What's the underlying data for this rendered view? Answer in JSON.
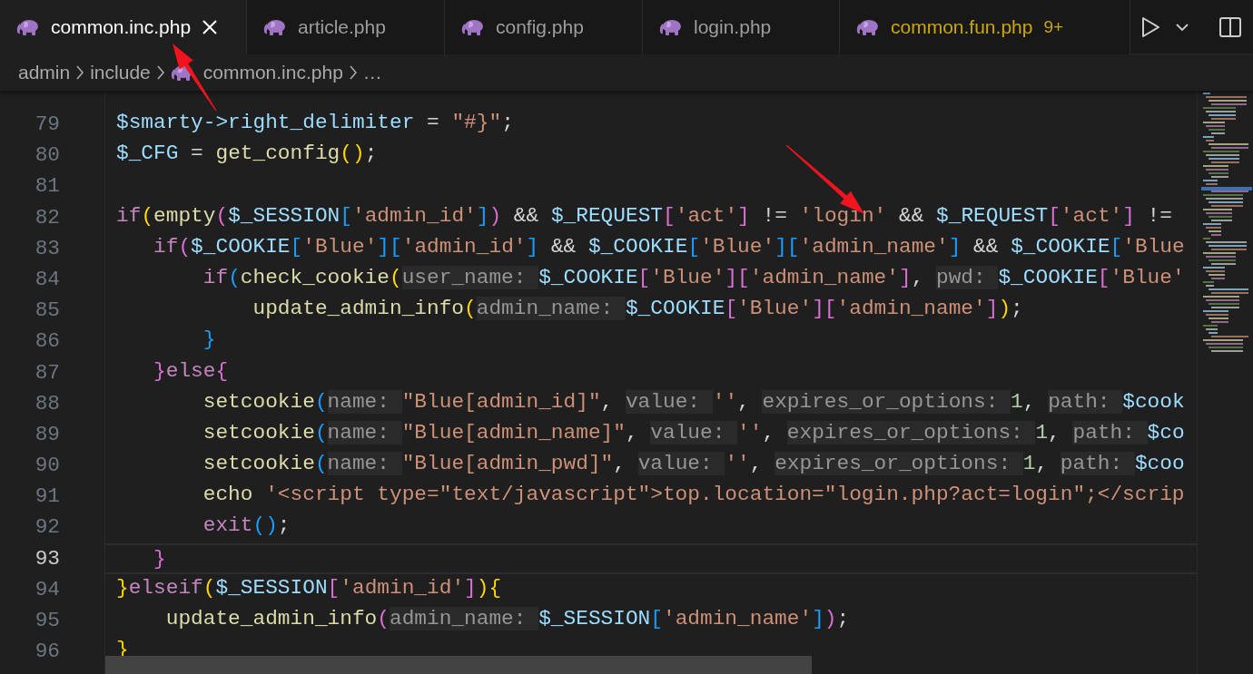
{
  "tabs": [
    {
      "label": "common.inc.php",
      "selected": true,
      "warning": false
    },
    {
      "label": "article.php",
      "selected": false,
      "warning": false
    },
    {
      "label": "config.php",
      "selected": false,
      "warning": false
    },
    {
      "label": "login.php",
      "selected": false,
      "warning": false
    },
    {
      "label": "common.fun.php",
      "selected": false,
      "warning": true,
      "problems": "9+"
    }
  ],
  "editor_actions": [
    {
      "kind": "run"
    },
    {
      "kind": "run-menu"
    },
    {
      "kind": "split"
    }
  ],
  "breadcrumb": [
    {
      "label": "admin",
      "kind": "folder"
    },
    {
      "label": "include",
      "kind": "folder"
    },
    {
      "label": "common.inc.php",
      "kind": "php-file"
    },
    {
      "label": "…",
      "kind": "symbol"
    }
  ],
  "lines": [
    {
      "number": "79",
      "current": false,
      "tokens": [
        {
          "text": "$smarty->right_delimiter",
          "kind": "var"
        },
        {
          "text": " = ",
          "kind": "op"
        },
        {
          "text": "\"#}\"",
          "kind": "str"
        },
        {
          "text": ";",
          "kind": "op"
        }
      ]
    },
    {
      "number": "80",
      "current": false,
      "tokens": [
        {
          "text": "$_CFG",
          "kind": "var"
        },
        {
          "text": " = ",
          "kind": "op"
        },
        {
          "text": "get_config",
          "kind": "fn"
        },
        {
          "text": "()",
          "kind": "b1"
        },
        {
          "text": ";",
          "kind": "op"
        }
      ]
    },
    {
      "number": "81",
      "current": false
    },
    {
      "number": "82",
      "current": false,
      "tokens": [
        {
          "text": "if",
          "kind": "kw"
        },
        {
          "text": "(",
          "kind": "b1"
        },
        {
          "text": "empty",
          "kind": "fn"
        },
        {
          "text": "(",
          "kind": "b2"
        },
        {
          "text": "$_SESSION",
          "kind": "var"
        },
        {
          "text": "[",
          "kind": "b3"
        },
        {
          "text": "'admin_id'",
          "kind": "str"
        },
        {
          "text": "]",
          "kind": "b3"
        },
        {
          "text": ")",
          "kind": "b2"
        },
        {
          "text": " && ",
          "kind": "op"
        },
        {
          "text": "$_REQUEST",
          "kind": "var"
        },
        {
          "text": "[",
          "kind": "b2"
        },
        {
          "text": "'act'",
          "kind": "str"
        },
        {
          "text": "]",
          "kind": "b2"
        },
        {
          "text": " != ",
          "kind": "op"
        },
        {
          "text": "'login'",
          "kind": "str"
        },
        {
          "text": " && ",
          "kind": "op"
        },
        {
          "text": "$_REQUEST",
          "kind": "var"
        },
        {
          "text": "[",
          "kind": "b2"
        },
        {
          "text": "'act'",
          "kind": "str"
        },
        {
          "text": "]",
          "kind": "b2"
        },
        {
          "text": " !=",
          "kind": "op"
        }
      ]
    },
    {
      "number": "83",
      "current": false,
      "tokens": [
        {
          "text": "   if",
          "kind": "kw"
        },
        {
          "text": "(",
          "kind": "b2"
        },
        {
          "text": "$_COOKIE",
          "kind": "var"
        },
        {
          "text": "[",
          "kind": "b3"
        },
        {
          "text": "'Blue'",
          "kind": "str"
        },
        {
          "text": "][",
          "kind": "b3"
        },
        {
          "text": "'admin_id'",
          "kind": "str"
        },
        {
          "text": "]",
          "kind": "b3"
        },
        {
          "text": " && ",
          "kind": "op"
        },
        {
          "text": "$_COOKIE",
          "kind": "var"
        },
        {
          "text": "[",
          "kind": "b3"
        },
        {
          "text": "'Blue'",
          "kind": "str"
        },
        {
          "text": "][",
          "kind": "b3"
        },
        {
          "text": "'admin_name'",
          "kind": "str"
        },
        {
          "text": "]",
          "kind": "b3"
        },
        {
          "text": " && ",
          "kind": "op"
        },
        {
          "text": "$_COOKIE",
          "kind": "var"
        },
        {
          "text": "[",
          "kind": "b3"
        },
        {
          "text": "'Blue",
          "kind": "str"
        }
      ]
    },
    {
      "number": "84",
      "current": false,
      "tokens": [
        {
          "text": "       if",
          "kind": "kw"
        },
        {
          "text": "(",
          "kind": "b3"
        },
        {
          "text": "check_cookie",
          "kind": "fn"
        },
        {
          "text": "(",
          "kind": "b1"
        },
        {
          "text": "user_name: ",
          "kind": "hint"
        },
        {
          "text": "$_COOKIE",
          "kind": "var"
        },
        {
          "text": "[",
          "kind": "b2"
        },
        {
          "text": "'Blue'",
          "kind": "str"
        },
        {
          "text": "][",
          "kind": "b2"
        },
        {
          "text": "'admin_name'",
          "kind": "str"
        },
        {
          "text": "]",
          "kind": "b2"
        },
        {
          "text": ", ",
          "kind": "op"
        },
        {
          "text": "pwd: ",
          "kind": "hint"
        },
        {
          "text": "$_COOKIE",
          "kind": "var"
        },
        {
          "text": "[",
          "kind": "b2"
        },
        {
          "text": "'Blue'",
          "kind": "str"
        }
      ]
    },
    {
      "number": "85",
      "current": false,
      "tokens": [
        {
          "text": "           update_admin_info",
          "kind": "fn"
        },
        {
          "text": "(",
          "kind": "b1"
        },
        {
          "text": "admin_name: ",
          "kind": "hint"
        },
        {
          "text": "$_COOKIE",
          "kind": "var"
        },
        {
          "text": "[",
          "kind": "b2"
        },
        {
          "text": "'Blue'",
          "kind": "str"
        },
        {
          "text": "][",
          "kind": "b2"
        },
        {
          "text": "'admin_name'",
          "kind": "str"
        },
        {
          "text": "]",
          "kind": "b2"
        },
        {
          "text": ")",
          "kind": "b1"
        },
        {
          "text": ";",
          "kind": "op"
        }
      ]
    },
    {
      "number": "86",
      "current": false,
      "tokens": [
        {
          "text": "       }",
          "kind": "b3"
        }
      ]
    },
    {
      "number": "87",
      "current": false,
      "tokens": [
        {
          "text": "   }",
          "kind": "b2"
        },
        {
          "text": "else",
          "kind": "kw"
        },
        {
          "text": "{",
          "kind": "b2"
        }
      ]
    },
    {
      "number": "88",
      "current": false,
      "tokens": [
        {
          "text": "       setcookie",
          "kind": "fn"
        },
        {
          "text": "(",
          "kind": "b3"
        },
        {
          "text": "name: ",
          "kind": "hint"
        },
        {
          "text": "\"Blue[admin_id]\"",
          "kind": "str"
        },
        {
          "text": ", ",
          "kind": "op"
        },
        {
          "text": "value: ",
          "kind": "hint"
        },
        {
          "text": "''",
          "kind": "str"
        },
        {
          "text": ", ",
          "kind": "op"
        },
        {
          "text": "expires_or_options: ",
          "kind": "hint"
        },
        {
          "text": "1",
          "kind": "num"
        },
        {
          "text": ", ",
          "kind": "op"
        },
        {
          "text": "path: ",
          "kind": "hint"
        },
        {
          "text": "$cook",
          "kind": "var"
        }
      ]
    },
    {
      "number": "89",
      "current": false,
      "tokens": [
        {
          "text": "       setcookie",
          "kind": "fn"
        },
        {
          "text": "(",
          "kind": "b3"
        },
        {
          "text": "name: ",
          "kind": "hint"
        },
        {
          "text": "\"Blue[admin_name]\"",
          "kind": "str"
        },
        {
          "text": ", ",
          "kind": "op"
        },
        {
          "text": "value: ",
          "kind": "hint"
        },
        {
          "text": "''",
          "kind": "str"
        },
        {
          "text": ", ",
          "kind": "op"
        },
        {
          "text": "expires_or_options: ",
          "kind": "hint"
        },
        {
          "text": "1",
          "kind": "num"
        },
        {
          "text": ", ",
          "kind": "op"
        },
        {
          "text": "path: ",
          "kind": "hint"
        },
        {
          "text": "$co",
          "kind": "var"
        }
      ]
    },
    {
      "number": "90",
      "current": false,
      "tokens": [
        {
          "text": "       setcookie",
          "kind": "fn"
        },
        {
          "text": "(",
          "kind": "b3"
        },
        {
          "text": "name: ",
          "kind": "hint"
        },
        {
          "text": "\"Blue[admin_pwd]\"",
          "kind": "str"
        },
        {
          "text": ", ",
          "kind": "op"
        },
        {
          "text": "value: ",
          "kind": "hint"
        },
        {
          "text": "''",
          "kind": "str"
        },
        {
          "text": ", ",
          "kind": "op"
        },
        {
          "text": "expires_or_options: ",
          "kind": "hint"
        },
        {
          "text": "1",
          "kind": "num"
        },
        {
          "text": ", ",
          "kind": "op"
        },
        {
          "text": "path: ",
          "kind": "hint"
        },
        {
          "text": "$coo",
          "kind": "var"
        }
      ]
    },
    {
      "number": "91",
      "current": false,
      "tokens": [
        {
          "text": "       echo ",
          "kind": "fn"
        },
        {
          "text": "'<script type=\"text/javascript\">top.location=\"login.php?act=login\";</scrip",
          "kind": "str"
        }
      ]
    },
    {
      "number": "92",
      "current": false,
      "tokens": [
        {
          "text": "       exit",
          "kind": "kw"
        },
        {
          "text": "()",
          "kind": "b3"
        },
        {
          "text": ";",
          "kind": "op"
        }
      ]
    },
    {
      "number": "93",
      "current": true,
      "tokens": [
        {
          "text": "   }",
          "kind": "b2"
        }
      ]
    },
    {
      "number": "94",
      "current": false,
      "tokens": [
        {
          "text": "}",
          "kind": "b1"
        },
        {
          "text": "elseif",
          "kind": "kw"
        },
        {
          "text": "(",
          "kind": "b1"
        },
        {
          "text": "$_SESSION",
          "kind": "var"
        },
        {
          "text": "[",
          "kind": "b2"
        },
        {
          "text": "'admin_id'",
          "kind": "str"
        },
        {
          "text": "]",
          "kind": "b2"
        },
        {
          "text": "){",
          "kind": "b1"
        }
      ]
    },
    {
      "number": "95",
      "current": false,
      "tokens": [
        {
          "text": "    update_admin_info",
          "kind": "fn"
        },
        {
          "text": "(",
          "kind": "b2"
        },
        {
          "text": "admin_name: ",
          "kind": "hint"
        },
        {
          "text": "$_SESSION",
          "kind": "var"
        },
        {
          "text": "[",
          "kind": "b3"
        },
        {
          "text": "'admin_name'",
          "kind": "str"
        },
        {
          "text": "]",
          "kind": "b3"
        },
        {
          "text": ")",
          "kind": "b2"
        },
        {
          "text": ";",
          "kind": "op"
        }
      ]
    },
    {
      "number": "96",
      "current": false,
      "tokens": [
        {
          "text": "}",
          "kind": "b1"
        }
      ]
    }
  ],
  "annotations": [
    {
      "kind": "arrow"
    },
    {
      "kind": "arrow"
    }
  ]
}
